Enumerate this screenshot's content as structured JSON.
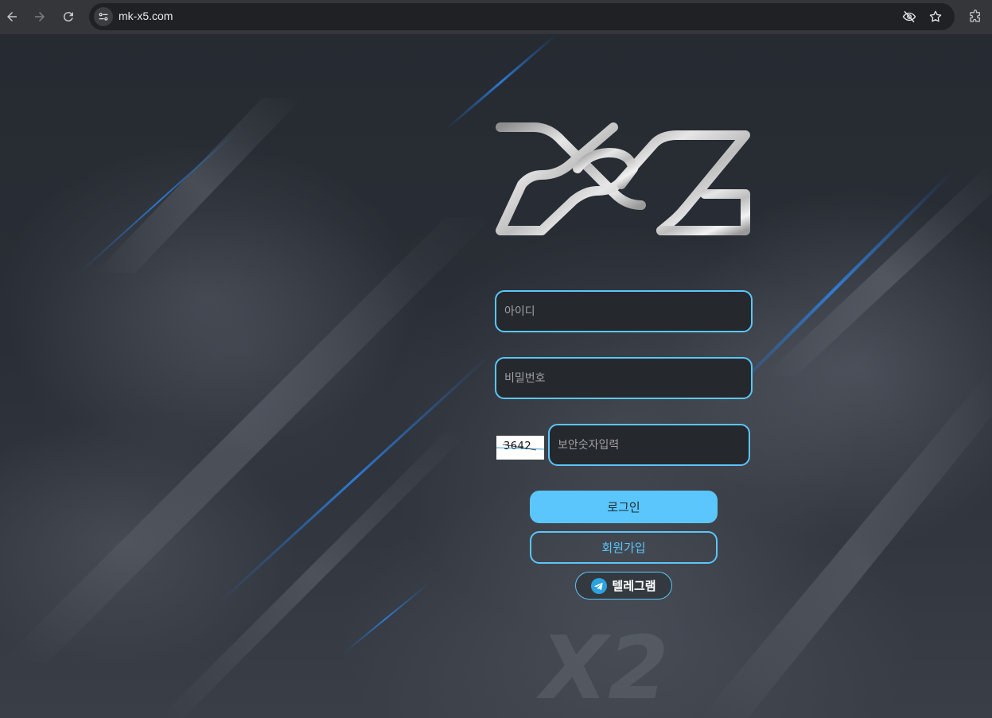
{
  "browser": {
    "url": "mk-x5.com",
    "icons": {
      "back": "arrow-left-icon",
      "forward": "arrow-right-icon",
      "reload": "reload-icon",
      "site_info": "tune-icon",
      "hide": "eye-off-icon",
      "bookmark": "star-icon",
      "extensions": "puzzle-icon"
    }
  },
  "login": {
    "logo_text": "X5",
    "username_placeholder": "아이디",
    "password_placeholder": "비밀번호",
    "captcha_code": "3642",
    "captcha_placeholder": "보안숫자입력",
    "login_button": "로그인",
    "signup_button": "회원가입",
    "telegram_button": "텔레그램"
  },
  "background": {
    "watermark": "X2"
  },
  "colors": {
    "accent": "#5bc6fb",
    "background": "#23272f",
    "chrome": "#35363a"
  }
}
